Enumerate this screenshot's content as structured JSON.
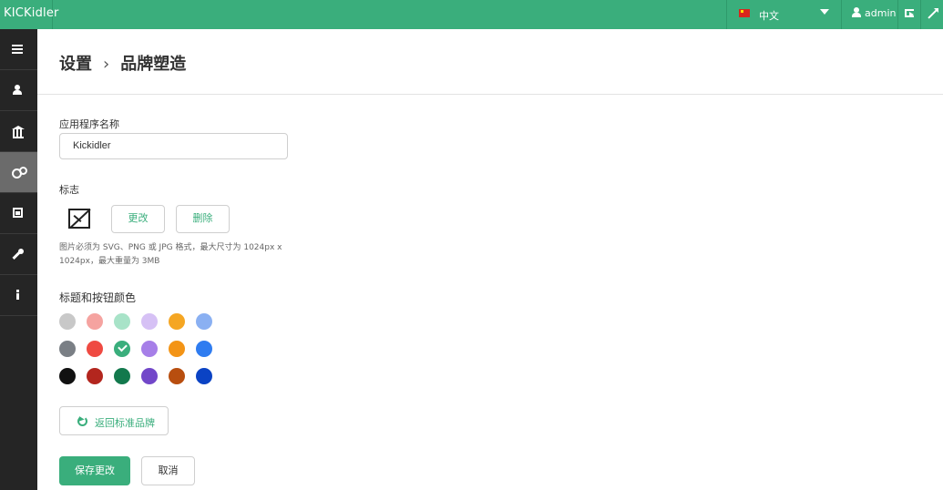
{
  "topbar": {
    "logo_text": "KICKidler",
    "language_label": "中文",
    "user_label": "admin"
  },
  "sidebar": {
    "items": [
      {
        "icon": "list-icon",
        "active": false
      },
      {
        "icon": "user-icon",
        "active": false
      },
      {
        "icon": "bank-icon",
        "active": false
      },
      {
        "icon": "gears-icon",
        "active": true
      },
      {
        "icon": "calendar-icon",
        "active": false
      },
      {
        "icon": "wrench-icon",
        "active": false
      },
      {
        "icon": "info-icon",
        "active": false
      }
    ]
  },
  "breadcrumb": {
    "parent": "设置",
    "separator": "›",
    "current": "品牌塑造"
  },
  "form": {
    "app_name_label": "应用程序名称",
    "app_name_value": "Kickidler",
    "logo_label": "标志",
    "change_button": "更改",
    "delete_button": "删除",
    "logo_hint": "图片必须为 SVG、PNG 或 JPG 格式，最大尺寸为 1024px x 1024px，最大重量为 3MB",
    "color_label": "标题和按钮颜色",
    "colors": [
      [
        "#c8c8c8",
        "#f5a3a0",
        "#a8e3c8",
        "#d6c1f5",
        "#f5a623",
        "#8ab0f2"
      ],
      [
        "#7a7f85",
        "#ef4a42",
        "#3aae7c",
        "#a67fe8",
        "#f39416",
        "#2f7cf0"
      ],
      [
        "#111111",
        "#b3261e",
        "#13794d",
        "#7247c9",
        "#b84e0f",
        "#0b43c4"
      ]
    ],
    "selected_color": "#3aae7c",
    "reset_button": "返回标准品牌",
    "save_button": "保存更改",
    "cancel_button": "取消"
  }
}
